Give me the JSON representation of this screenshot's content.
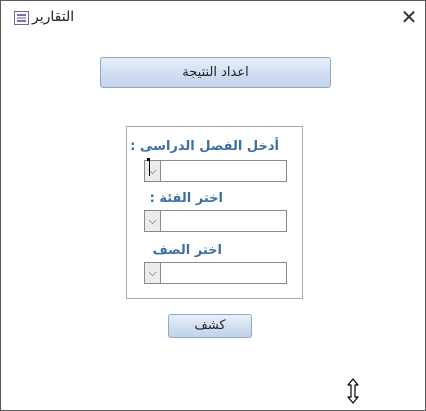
{
  "window": {
    "title": "التقارير",
    "close_symbol": "✕",
    "title_icon": "report-icon"
  },
  "buttons": {
    "result_label": "اعداد النتيجة",
    "reveal_label": "كشف"
  },
  "form": {
    "semester_label": "أدخل الفصل الدراسى :",
    "semester_value": "",
    "category_label": "اختر الفئة :",
    "category_value": "",
    "grade_label": "اختر الصف",
    "grade_value": "",
    "dropdown_symbol": "⌵"
  },
  "cursor": "resize-vertical-cursor-icon"
}
